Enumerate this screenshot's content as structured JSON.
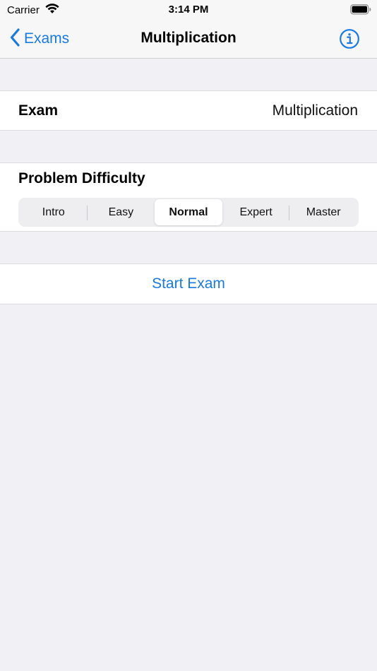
{
  "status_bar": {
    "carrier": "Carrier",
    "time": "3:14 PM",
    "wifi_icon": "wifi-icon",
    "battery_icon": "battery-icon"
  },
  "nav": {
    "back_label": "Exams",
    "title": "Multiplication",
    "info_icon": "info-icon"
  },
  "exam_row": {
    "label": "Exam",
    "value": "Multiplication"
  },
  "difficulty": {
    "title": "Problem Difficulty",
    "options": [
      "Intro",
      "Easy",
      "Normal",
      "Expert",
      "Master"
    ],
    "selected": "Normal"
  },
  "actions": {
    "start_label": "Start Exam"
  },
  "colors": {
    "accent": "#1a7ae4",
    "background": "#f0f0f5"
  }
}
